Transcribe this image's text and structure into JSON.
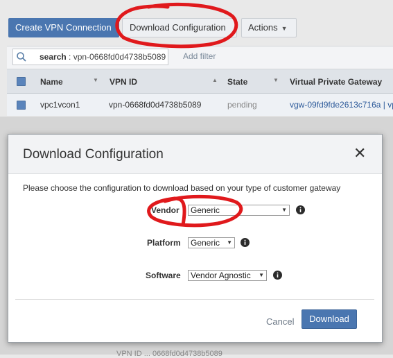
{
  "toolbar": {
    "create_label": "Create VPN Connection",
    "download_config_label": "Download Configuration",
    "actions_label": "Actions"
  },
  "filter": {
    "search_key": "search",
    "search_value": ": vpn-0668fd0d4738b5089",
    "add_filter_label": "Add filter"
  },
  "table": {
    "columns": [
      "Name",
      "VPN ID",
      "State",
      "Virtual Private Gateway"
    ],
    "rows": [
      {
        "name": "vpc1vcon1",
        "vpn_id": "vpn-0668fd0d4738b5089",
        "state": "pending",
        "vpg": "vgw-09fd9fde2613c716a | vp"
      }
    ]
  },
  "modal": {
    "title": "Download Configuration",
    "instruction": "Please choose the configuration to download based on your type of customer gateway",
    "vendor_label": "Vendor",
    "vendor_value": "Generic",
    "platform_label": "Platform",
    "platform_value": "Generic",
    "software_label": "Software",
    "software_value": "Vendor Agnostic",
    "cancel_label": "Cancel",
    "download_label": "Download"
  },
  "footer": {
    "partial_text": "VPN ID ... 0668fd0d4738b5089"
  },
  "colors": {
    "primary": "#4a76b0",
    "annotation": "#e0191c",
    "link": "#2d5a9a"
  }
}
